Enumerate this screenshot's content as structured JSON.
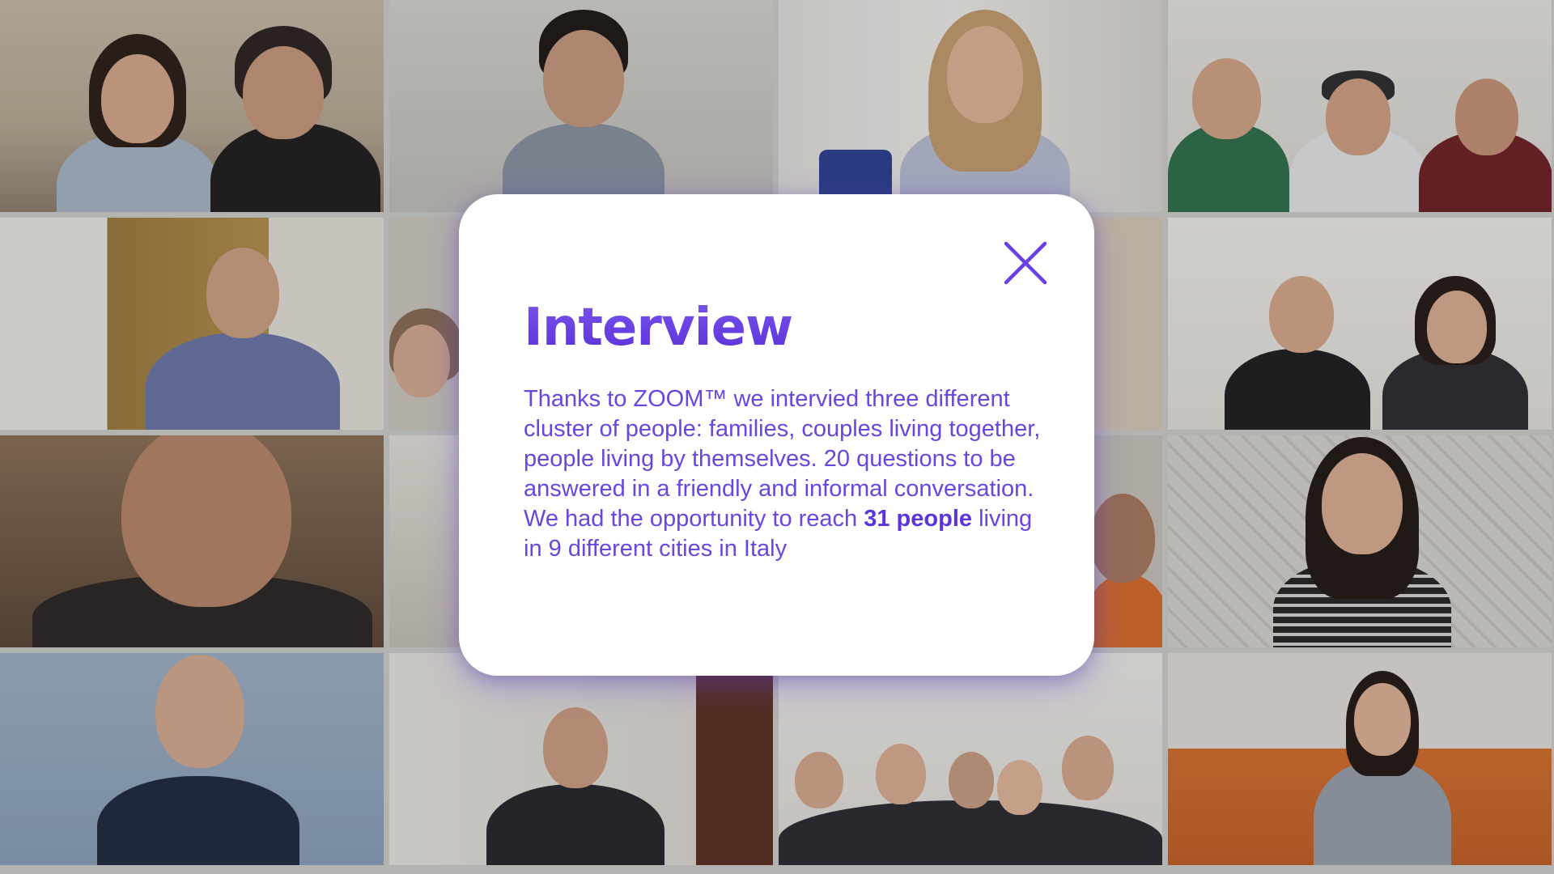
{
  "modal": {
    "title": "Interview",
    "body_before": "Thanks to ZOOM™ we intervied three different cluster of people: families, couples living together, people living by themselves. 20 questions to be answered in a friendly and informal conversation. We had the opportunity to reach ",
    "body_highlight": "31 people",
    "body_after": " living in 9 different cities in Italy",
    "close_icon": "close-icon",
    "accent_color": "#6a3fe6"
  },
  "video_grid": {
    "tiles": [
      {
        "name": "video-tile-1"
      },
      {
        "name": "video-tile-2"
      },
      {
        "name": "video-tile-3"
      },
      {
        "name": "video-tile-4"
      },
      {
        "name": "video-tile-5"
      },
      {
        "name": "video-tile-6"
      },
      {
        "name": "video-tile-7"
      },
      {
        "name": "video-tile-8"
      },
      {
        "name": "video-tile-9"
      },
      {
        "name": "video-tile-10"
      },
      {
        "name": "video-tile-11"
      },
      {
        "name": "video-tile-12"
      },
      {
        "name": "video-tile-13"
      },
      {
        "name": "video-tile-14"
      },
      {
        "name": "video-tile-15"
      },
      {
        "name": "video-tile-16"
      }
    ]
  }
}
